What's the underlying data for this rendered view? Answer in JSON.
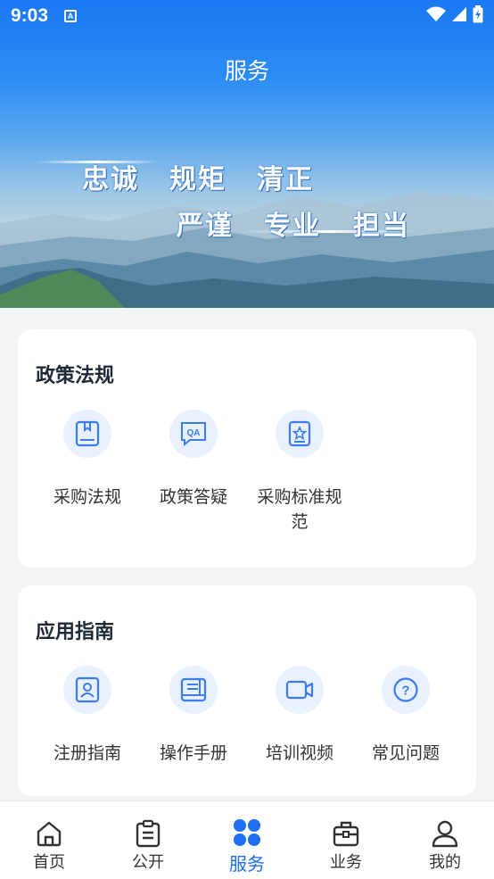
{
  "status_bar": {
    "time": "9:03",
    "notification_badge": "A"
  },
  "header": {
    "title": "服务"
  },
  "banner": {
    "slogan_row1": [
      "忠诚",
      "规矩",
      "清正"
    ],
    "slogan_row2": [
      "严谨",
      "专业",
      "担当"
    ]
  },
  "sections": [
    {
      "title": "政策法规",
      "items": [
        {
          "label": "采购法规",
          "icon": "book-icon"
        },
        {
          "label": "政策答疑",
          "icon": "qa-icon"
        },
        {
          "label": "采购标准规范",
          "icon": "badge-star-icon"
        }
      ]
    },
    {
      "title": "应用指南",
      "items": [
        {
          "label": "注册指南",
          "icon": "contact-icon"
        },
        {
          "label": "操作手册",
          "icon": "manual-icon"
        },
        {
          "label": "培训视频",
          "icon": "video-icon"
        },
        {
          "label": "常见问题",
          "icon": "question-icon"
        }
      ]
    }
  ],
  "tabbar": {
    "active": "服务",
    "accent_color": "#1d6ef2",
    "tabs": [
      {
        "label": "首页",
        "icon": "home-icon"
      },
      {
        "label": "公开",
        "icon": "clipboard-icon"
      },
      {
        "label": "服务",
        "icon": "services-grid-icon"
      },
      {
        "label": "业务",
        "icon": "briefcase-icon"
      },
      {
        "label": "我的",
        "icon": "user-icon"
      }
    ]
  }
}
